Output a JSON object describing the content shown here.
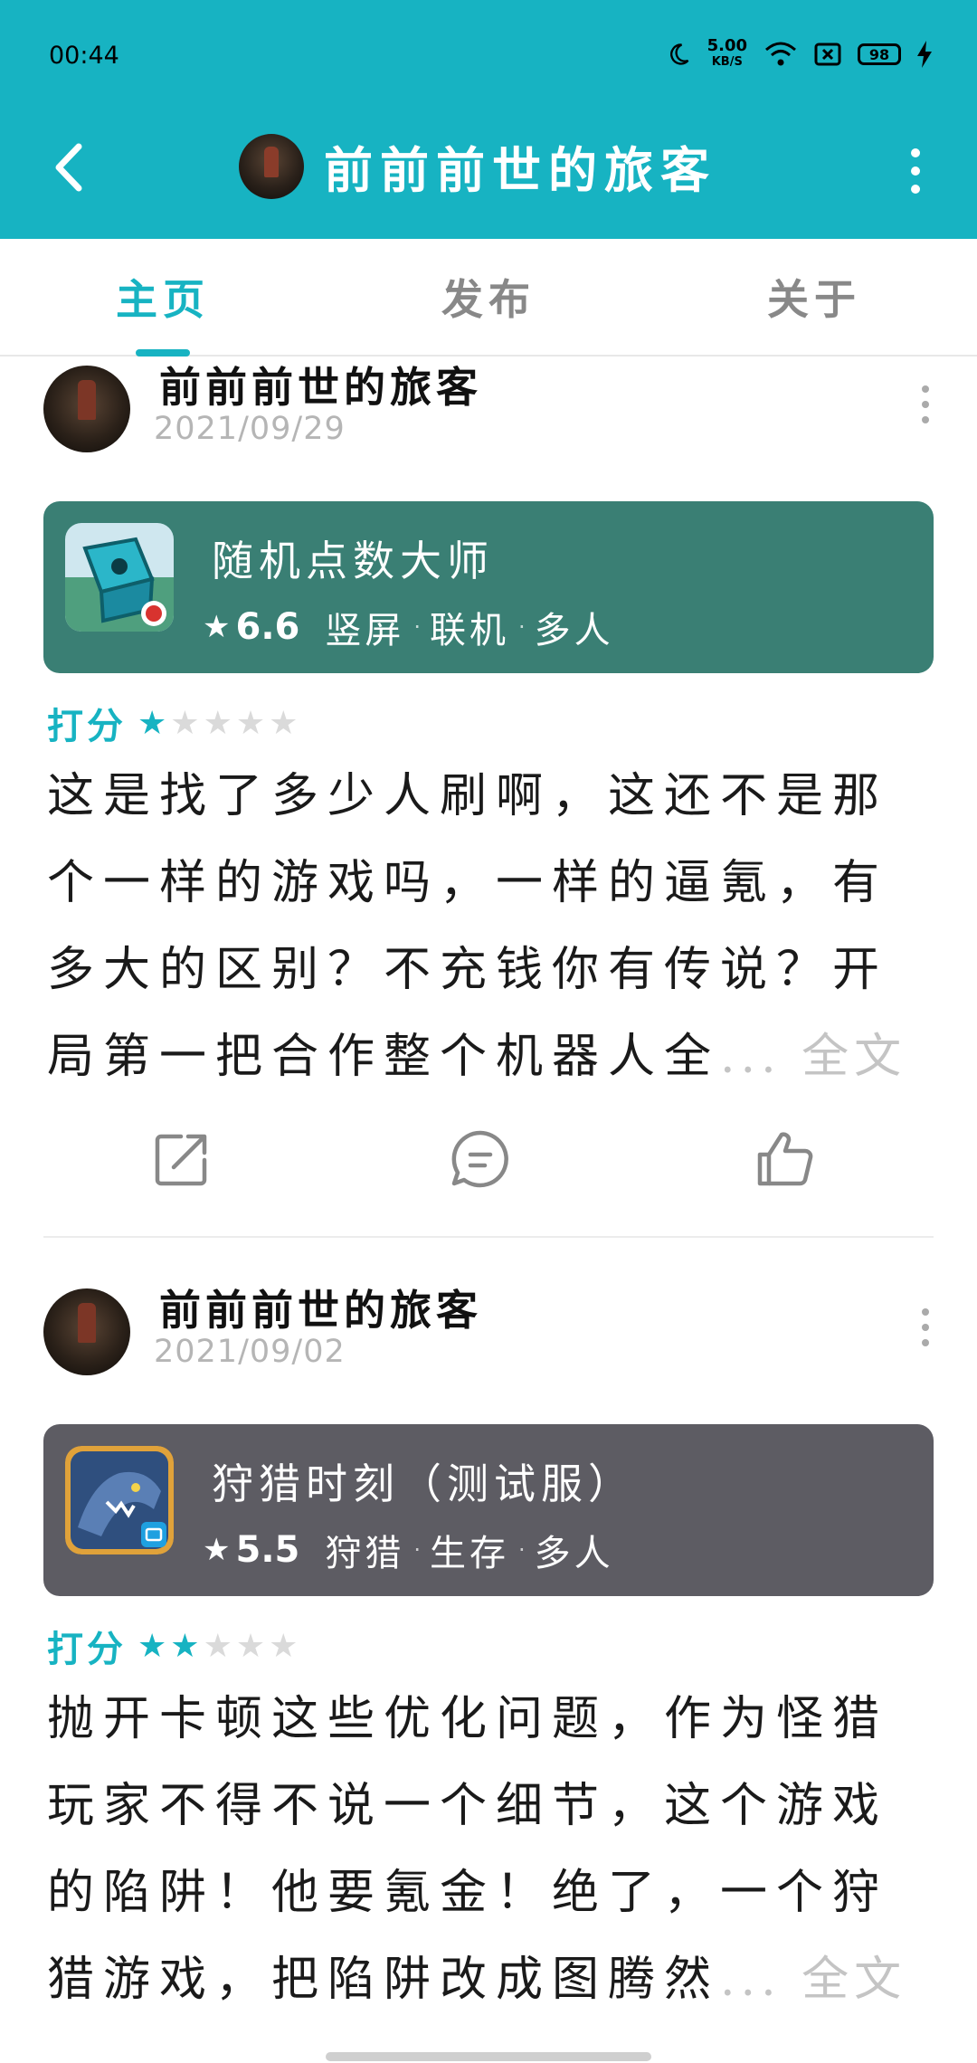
{
  "status_bar": {
    "time": "00:44",
    "net_speed": "5.00",
    "net_unit": "KB/S",
    "battery": "98"
  },
  "header": {
    "title": "前前前世的旅客"
  },
  "tabs": [
    {
      "label": "主页",
      "active": true
    },
    {
      "label": "发布",
      "active": false
    },
    {
      "label": "关于",
      "active": false
    }
  ],
  "posts": [
    {
      "author": "前前前世的旅客",
      "date": "2021/09/29",
      "game": {
        "name": "随机点数大师",
        "score": "6.6",
        "tags": [
          "竖屏",
          "联机",
          "多人"
        ],
        "card_color": "#3a7f74"
      },
      "rating_label": "打分",
      "stars": 1,
      "review_lines": [
        "这是找了多少人刷啊，这还不是那",
        "个一样的游戏吗，一样的逼氪，有",
        "多大的区别？不充钱你有传说？开",
        "局第一把合作整个机器人全"
      ],
      "more_label": "... 全文"
    },
    {
      "author": "前前前世的旅客",
      "date": "2021/09/02",
      "game": {
        "name": "狩猎时刻（测试服）",
        "score": "5.5",
        "tags": [
          "狩猎",
          "生存",
          "多人"
        ],
        "card_color": "#5d5c63"
      },
      "rating_label": "打分",
      "stars": 2,
      "review_lines": [
        "抛开卡顿这些优化问题，作为怪猎",
        "玩家不得不说一个细节，这个游戏",
        "的陷阱！他要氪金！绝了，一个狩",
        "猎游戏，把陷阱改成图腾然"
      ],
      "more_label": "... 全文"
    }
  ]
}
